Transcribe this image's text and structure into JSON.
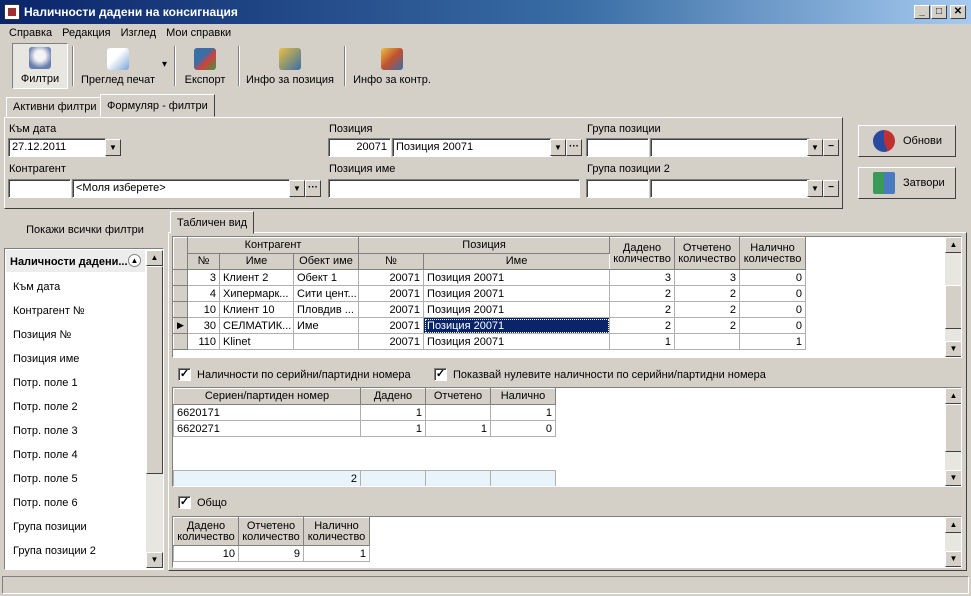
{
  "window": {
    "title": "Наличности дадени на консигнация",
    "min": "_",
    "max": "□",
    "close": "✕"
  },
  "menu": [
    "Справка",
    "Редакция",
    "Изглед",
    "Мои справки"
  ],
  "toolbar": {
    "filters": "Филтри",
    "preview": "Преглед печат",
    "export": "Експорт",
    "pos_info": "Инфо за позиция",
    "contr_info": "Инфо за контр.",
    "dropdown_arrow": "▾"
  },
  "tabs": {
    "active": "Активни филтри",
    "form": "Формуляр - филтри"
  },
  "form": {
    "date_label": "Към дата",
    "date_value": "27.12.2011",
    "contr_label": "Контрагент",
    "contr_id": "",
    "contr_value": "<Моля изберете>",
    "pos_label": "Позиция",
    "pos_id": "20071",
    "pos_value": "Позиция 20071",
    "pos_name_label": "Позиция име",
    "pos_name_value": "",
    "group_label": "Група позиции",
    "group2_label": "Група позиции 2",
    "ellipsis": "···",
    "minus": "−",
    "dd_arrow": "▼"
  },
  "buttons": {
    "refresh": "Обнови",
    "close": "Затвори"
  },
  "filters": {
    "show_all": "Покажи всички филтри",
    "header": "Наличности дадени...",
    "items": [
      "Към дата",
      "Контрагент №",
      "Позиция №",
      "Позиция име",
      "Потр. поле 1",
      "Потр. поле 2",
      "Потр. поле 3",
      "Потр. поле 4",
      "Потр. поле 5",
      "Потр. поле 6",
      "Група позиции",
      "Група позиции 2"
    ]
  },
  "table_tab": "Табличен вид",
  "main_table": {
    "group_contr": "Контрагент",
    "group_pos": "Позиция",
    "h_no": "№",
    "h_name": "Име",
    "h_obj": "Обект име",
    "h_pno": "№",
    "h_pname": "Име",
    "h_given": "Дадено количество",
    "h_reported": "Отчетено количество",
    "h_avail": "Налично количество",
    "rows": [
      [
        "3",
        "Клиент 2",
        "Обект 1",
        "20071",
        "Позиция 20071",
        "3",
        "3",
        "0"
      ],
      [
        "4",
        "Хипермарк...",
        "Сити цент...",
        "20071",
        "Позиция 20071",
        "2",
        "2",
        "0"
      ],
      [
        "10",
        "Клиент 10",
        "Пловдив ...",
        "20071",
        "Позиция 20071",
        "2",
        "2",
        "0"
      ],
      [
        "30",
        "СЕЛМАТИК...",
        "Име",
        "20071",
        "Позиция 20071",
        "2",
        "2",
        "0"
      ],
      [
        "110",
        "Klinet",
        "",
        "20071",
        "Позиция 20071",
        "1",
        "",
        "1"
      ]
    ],
    "current_marker": "▶"
  },
  "serial": {
    "chk1": "Наличности по серийни/партидни номера",
    "chk2": "Показвай нулевите наличности по серийни/партидни номера",
    "check_mark": "✓",
    "h_serial": "Сериен/партиден номер",
    "h_given": "Дадено",
    "h_reported": "Отчетено",
    "h_avail": "Налично",
    "rows": [
      [
        "6620171",
        "1",
        "",
        "1"
      ],
      [
        "6620271",
        "1",
        "1",
        "0"
      ]
    ],
    "total": "2"
  },
  "total": {
    "chk": "Общо",
    "h_given": "Дадено количество",
    "h_reported": "Отчетено количество",
    "h_avail": "Налично количество",
    "row": [
      "10",
      "9",
      "1"
    ]
  },
  "scroll": {
    "up": "▲",
    "down": "▼"
  }
}
